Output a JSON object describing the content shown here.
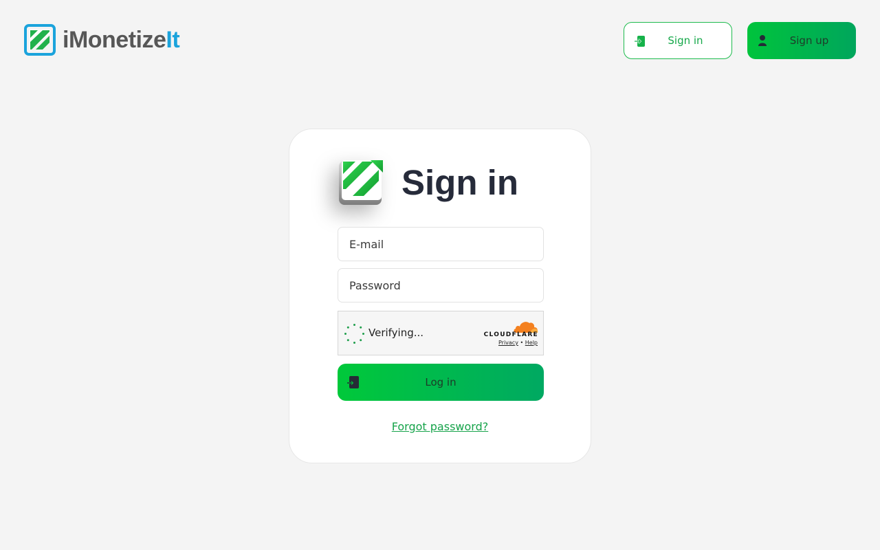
{
  "header": {
    "logo_text_main": "iMonetize",
    "logo_text_accent": "It",
    "signin_label": "Sign in",
    "signup_label": "Sign up"
  },
  "card": {
    "title": "Sign in",
    "email_placeholder": "E-mail",
    "password_placeholder": "Password",
    "captcha": {
      "status": "Verifying...",
      "brand": "CLOUDFLARE",
      "privacy_label": "Privacy",
      "separator": "•",
      "help_label": "Help"
    },
    "login_label": "Log in",
    "forgot_label": "Forgot password?"
  },
  "colors": {
    "brand_green": "#00c43c",
    "brand_blue": "#1ba3dc",
    "link_green": "#16a34a",
    "cloudflare_orange": "#f48120"
  },
  "icons": {
    "logo": "imonetizeit-logo-icon",
    "signin": "login-icon",
    "signup": "user-icon",
    "login": "login-door-icon",
    "cloudflare": "cloudflare-cloud-icon"
  }
}
